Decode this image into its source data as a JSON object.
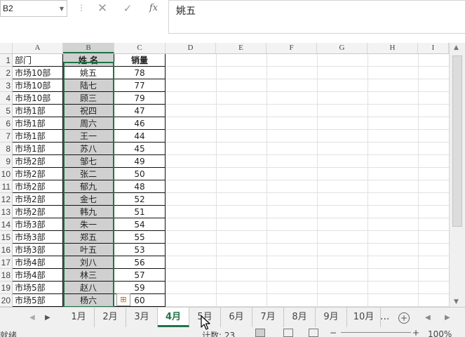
{
  "formula_bar": {
    "name_box": "B2",
    "fx_label": "fx",
    "cancel_glyph": "✕",
    "enter_glyph": "✓",
    "content": "姚五"
  },
  "columns": [
    "A",
    "B",
    "C",
    "D",
    "E",
    "F",
    "G",
    "H",
    "I"
  ],
  "selected_column": "B",
  "row_numbers": [
    "1",
    "2",
    "3",
    "4",
    "5",
    "6",
    "7",
    "8",
    "9",
    "10",
    "11",
    "12",
    "13",
    "14",
    "15",
    "16",
    "17",
    "18",
    "19",
    "20"
  ],
  "table": {
    "headers": [
      "部门",
      "姓  名",
      "销量"
    ],
    "rows": [
      [
        "市场10部",
        "姚五",
        "78"
      ],
      [
        "市场10部",
        "陆七",
        "77"
      ],
      [
        "市场10部",
        "顾三",
        "79"
      ],
      [
        "市场1部",
        "祝四",
        "47"
      ],
      [
        "市场1部",
        "周六",
        "46"
      ],
      [
        "市场1部",
        "王一",
        "44"
      ],
      [
        "市场1部",
        "苏八",
        "45"
      ],
      [
        "市场2部",
        "邹七",
        "49"
      ],
      [
        "市场2部",
        "张二",
        "50"
      ],
      [
        "市场2部",
        "郁九",
        "48"
      ],
      [
        "市场2部",
        "金七",
        "52"
      ],
      [
        "市场2部",
        "韩九",
        "51"
      ],
      [
        "市场3部",
        "朱一",
        "54"
      ],
      [
        "市场3部",
        "郑五",
        "55"
      ],
      [
        "市场3部",
        "叶五",
        "53"
      ],
      [
        "市场4部",
        "刘八",
        "56"
      ],
      [
        "市场4部",
        "林三",
        "57"
      ],
      [
        "市场5部",
        "赵八",
        "59"
      ],
      [
        "市场5部",
        "杨六",
        "60"
      ]
    ]
  },
  "sheet_tabs": [
    "1月",
    "2月",
    "3月",
    "4月",
    "5月",
    "6月",
    "7月",
    "8月",
    "9月",
    "10月"
  ],
  "active_tab": "4月",
  "tab_more": "...",
  "status": {
    "ready": "就绪",
    "count": "计数: 23",
    "zoom": "100%"
  },
  "colors": {
    "accent": "#217346",
    "selection_fill": "#d0d0d0"
  }
}
